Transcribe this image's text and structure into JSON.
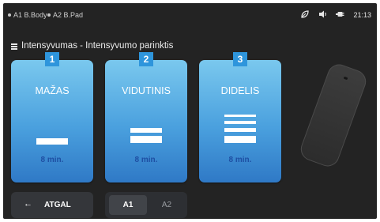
{
  "status_bar": {
    "devices": [
      "A1 B.Body",
      "A2 B.Pad"
    ],
    "time": "21:13",
    "icons": [
      "leaf-icon",
      "volume-icon",
      "battery-plug-icon"
    ]
  },
  "title": "Intensyvumas - Intensyvumo parinktis",
  "cards": [
    {
      "number": "1",
      "label": "MAŽAS",
      "duration": "8 min.",
      "level": 1
    },
    {
      "number": "2",
      "label": "VIDUTINIS",
      "duration": "8 min.",
      "level": 2
    },
    {
      "number": "3",
      "label": "DIDELIS",
      "duration": "8 min.",
      "level": 3
    }
  ],
  "back_button": {
    "label": "ATGAL",
    "icon": "arrow-left-icon"
  },
  "channel_toggle": {
    "options": [
      "A1",
      "A2"
    ],
    "selected": "A1"
  },
  "colors": {
    "background": "#232323",
    "card_top": "#7ac8ee",
    "card_bottom": "#2f79c6",
    "badge": "#2e95dc",
    "duration_text": "#1e4fa3"
  }
}
